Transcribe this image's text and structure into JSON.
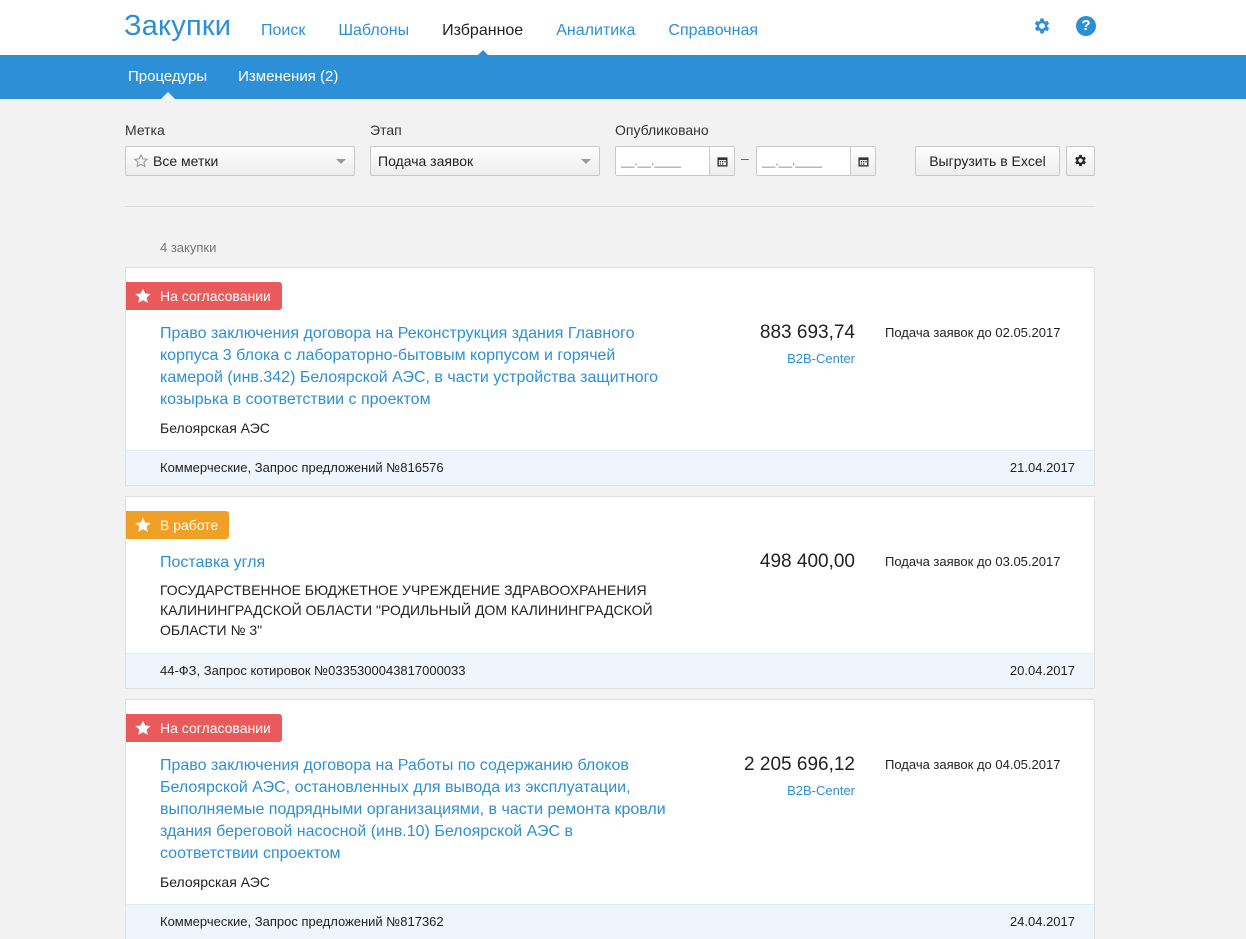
{
  "header": {
    "logo": "Закупки",
    "nav": [
      "Поиск",
      "Шаблоны",
      "Избранное",
      "Аналитика",
      "Справочная"
    ],
    "active_nav": "Избранное",
    "help_label": "?"
  },
  "subnav": {
    "items": [
      "Процедуры",
      "Изменения (2)"
    ],
    "active": "Процедуры"
  },
  "filters": {
    "tag_label": "Метка",
    "tag_value": "Все метки",
    "stage_label": "Этап",
    "stage_value": "Подача заявок",
    "published_label": "Опубликовано",
    "date_from_placeholder": "__.__.____",
    "date_to_placeholder": "__.__.____",
    "date_separator": "–",
    "export_label": "Выгрузить в Excel"
  },
  "results": {
    "count_label": "4 закупки"
  },
  "cards": [
    {
      "status": "На согласовании",
      "title": "Право заключения договора на Реконструкция здания Главного корпуса 3 блока с лабораторно-бытовым корпусом и горячей камерой (инв.342) Белоярской АЭС, в части устройства защитного козырька в соответствии с проектом",
      "org": "Белоярская АЭС",
      "price": "883 693,74",
      "platform": "B2B-Center",
      "deadline": "Подача заявок до 02.05.2017",
      "type": "Коммерческие, Запрос предложений №816576",
      "date": "21.04.2017"
    },
    {
      "status": "В работе",
      "title": "Поставка угля",
      "org": "ГОСУДАРСТВЕННОЕ БЮДЖЕТНОЕ УЧРЕЖДЕНИЕ ЗДРАВООХРАНЕНИЯ КАЛИНИНГРАДСКОЙ ОБЛАСТИ \"РОДИЛЬНЫЙ ДОМ КАЛИНИНГРАДСКОЙ ОБЛАСТИ № 3\"",
      "price": "498 400,00",
      "deadline": "Подача заявок до 03.05.2017",
      "type": "44-ФЗ, Запрос котировок №0335300043817000033",
      "date": "20.04.2017"
    },
    {
      "status": "На согласовании",
      "title": "Право заключения договора на Работы по содержанию блоков Белоярской АЭС, остановленных для вывода из эксплуатации, выполняемые подрядными организациями, в части ремонта кровли здания береговой насосной (инв.10) Белоярской АЭС в соответствии спроектом",
      "org": "Белоярская АЭС",
      "price": "2 205 696,12",
      "platform": "B2B-Center",
      "deadline": "Подача заявок до 04.05.2017",
      "type": "Коммерческие, Запрос предложений №817362",
      "date": "24.04.2017"
    }
  ],
  "colors": {
    "accent": "#2d8fd6",
    "status_review": "#ea5a5a",
    "status_work": "#f0a025"
  }
}
